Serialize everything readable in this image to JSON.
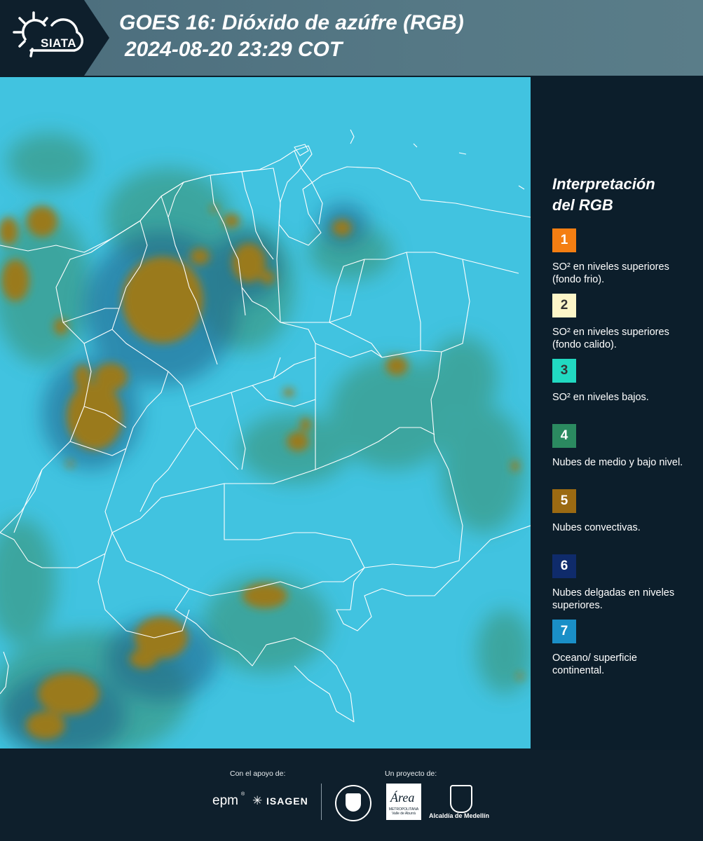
{
  "header": {
    "logo_text": "SIATA",
    "title_line1": "GOES 16: Dióxido de azúfre (RGB)",
    "title_line2": "2024-08-20 23:29 COT"
  },
  "legend": {
    "title_line1": "Interpretación",
    "title_line2": "del RGB",
    "items": [
      {
        "num": "1",
        "label": "SO² en niveles superiores (fondo frio).",
        "color": "#f47e12"
      },
      {
        "num": "2",
        "label": "SO² en niveles superiores (fondo calido).",
        "color": "#fdf6c8"
      },
      {
        "num": "3",
        "label": "SO² en niveles bajos.",
        "color": "#21d9c1"
      },
      {
        "num": "4",
        "label": "Nubes de medio y bajo nivel.",
        "color": "#2b8a60"
      },
      {
        "num": "5",
        "label": "Nubes convectivas.",
        "color": "#9b6a12"
      },
      {
        "num": "6",
        "label": "Nubes delgadas en niveles superiores.",
        "color": "#0f2b6b"
      },
      {
        "num": "7",
        "label": "Oceano/ superficie continental.",
        "color": "#1a8fc7"
      }
    ]
  },
  "footer": {
    "support_label": "Con el apoyo de:",
    "project_label": "Un proyecto de:",
    "sponsor_epm": "epm",
    "sponsor_isagen": "ISAGEN",
    "sponsor_area": "Área",
    "sponsor_area_sub": "METROPOLITANA Valle de Aburrá",
    "sponsor_medellin": "Alcaldía de Medellín"
  },
  "map_colors": {
    "background": "#41c3e0",
    "convective": "#9a7a1e",
    "mid_low": "#3c9c88",
    "thin_upper": "#1b5d86",
    "borders": "#ffffff"
  }
}
